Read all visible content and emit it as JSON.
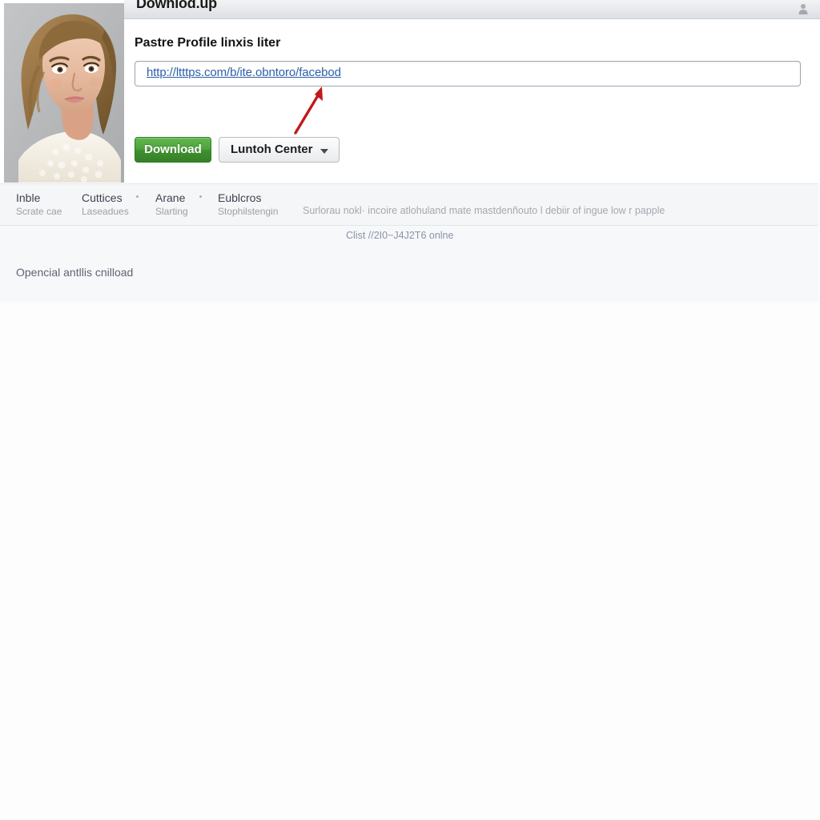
{
  "window": {
    "title": "Downlod.up",
    "titlebar_icon": "person-icon"
  },
  "photo": {
    "alt_name": "profile-portrait-photo"
  },
  "form": {
    "heading": "Pastre Profile linxis liter",
    "url_input": {
      "value": "http://ltttps.com/b/ite.obntoro/facebod",
      "placeholder": "Pastre Profile linxis liter"
    },
    "download_button": "Download",
    "dropdown_button": "Luntoh Center",
    "dropdown_icon": "chevron-down-icon",
    "annotation_arrow": "red-arrow-icon"
  },
  "footer_nav": {
    "columns": [
      {
        "title": "Inble",
        "sub": "Scrate cae"
      },
      {
        "title": "Cuttices",
        "sub": "Laseadues"
      },
      {
        "title": "Arane",
        "sub": "Slarting"
      },
      {
        "title": "Eublcros",
        "sub": "Stophilstengin"
      }
    ],
    "tagline": "Surlorau nokl· incoire atlohuland mate mastdenñouto l debiir of ingue low r papple"
  },
  "sub_area": {
    "online_link": "Clist //2I0~J4J2T6 onlne",
    "bottom_note": "Opencial antllis cnilload"
  },
  "colors": {
    "download_green": "#4da23b",
    "link_blue": "#2b5fa8",
    "arrow_red": "#c1191b",
    "titlebar_gray": "#e6e8eb",
    "footer_gray": "#f5f6f7"
  }
}
